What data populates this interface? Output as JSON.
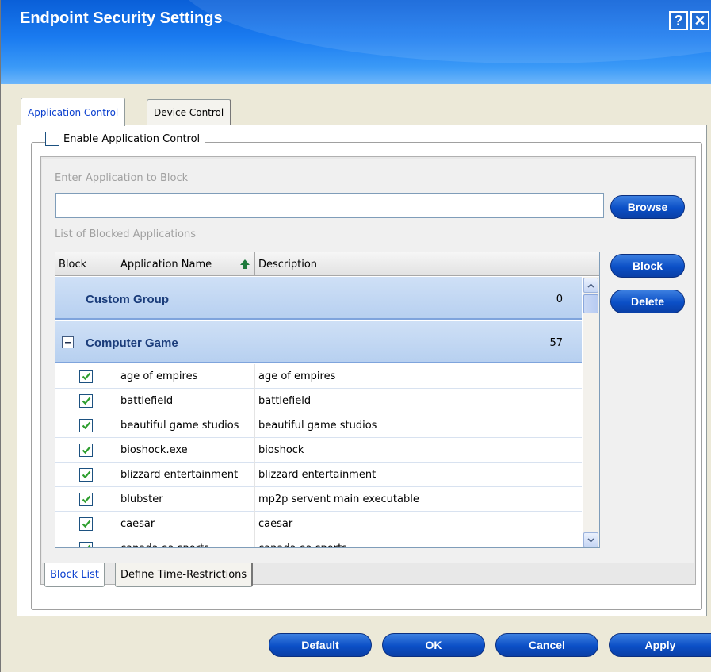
{
  "window": {
    "title": "Endpoint Security Settings",
    "help_glyph": "?",
    "close_glyph": "✕"
  },
  "tabs": [
    {
      "label": "Application Control",
      "active": true
    },
    {
      "label": "Device Control",
      "active": false
    }
  ],
  "app_control": {
    "enable_label": "Enable Application Control",
    "enable_checked": false,
    "enter_label": "Enter Application to Block",
    "input_value": "",
    "list_label": "List of Blocked Applications",
    "browse_label": "Browse",
    "block_label": "Block",
    "delete_label": "Delete"
  },
  "table": {
    "headers": {
      "block": "Block",
      "name": "Application Name",
      "desc": "Description"
    },
    "groups": [
      {
        "name": "Custom Group",
        "count": "0"
      },
      {
        "name": "Computer Game",
        "count": "57",
        "collapse_glyph": "−"
      }
    ],
    "rows": [
      {
        "name": "age of empires",
        "desc": "age of empires",
        "checked": true
      },
      {
        "name": "battlefield",
        "desc": "battlefield",
        "checked": true
      },
      {
        "name": "beautiful game studios",
        "desc": "beautiful game studios",
        "checked": true
      },
      {
        "name": "bioshock.exe",
        "desc": "bioshock",
        "checked": true
      },
      {
        "name": "blizzard entertainment",
        "desc": "blizzard entertainment",
        "checked": true
      },
      {
        "name": "blubster",
        "desc": "mp2p servent main executable",
        "checked": true
      },
      {
        "name": "caesar",
        "desc": "caesar",
        "checked": true
      },
      {
        "name": "canada ea sports",
        "desc": "canada ea sports",
        "checked": true
      }
    ]
  },
  "bottom_tabs": [
    {
      "label": "Block List",
      "active": true
    },
    {
      "label": "Define Time-Restrictions",
      "active": false
    }
  ],
  "footer": {
    "default_label": "Default",
    "ok_label": "OK",
    "cancel_label": "Cancel",
    "apply_label": "Apply"
  },
  "colors": {
    "title_blue": "#0A5FD8",
    "button_blue": "#0B4FC6",
    "group_text": "#1A3C7A",
    "check_green": "#2E9E2E"
  }
}
